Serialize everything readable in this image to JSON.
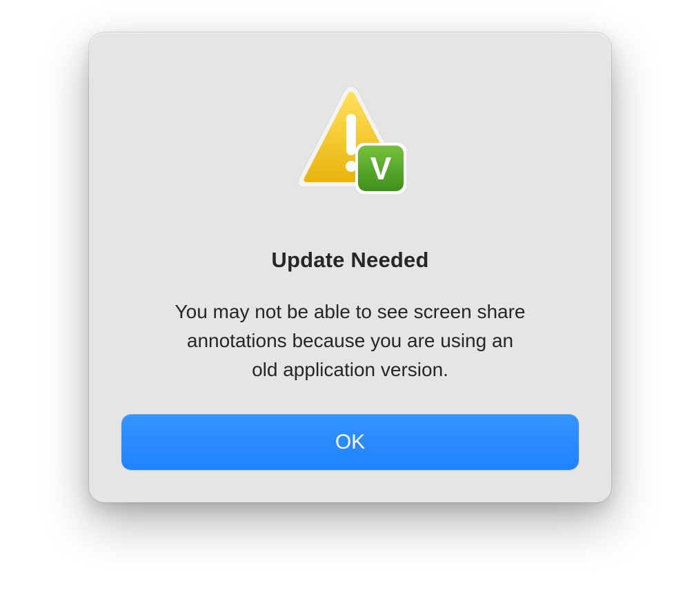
{
  "dialog": {
    "icon": "warning-triangle-with-app-badge-icon",
    "badge_letter": "V",
    "title": "Update Needed",
    "message_lines": [
      "You may not be able to see screen share",
      "annotations because you are using an",
      "old application version."
    ],
    "ok_label": "OK"
  },
  "colors": {
    "dialog_background": "#e5e5e5",
    "button_blue": "#2589ff",
    "warning_yellow": "#f5c518",
    "badge_green": "#5aa82a"
  }
}
